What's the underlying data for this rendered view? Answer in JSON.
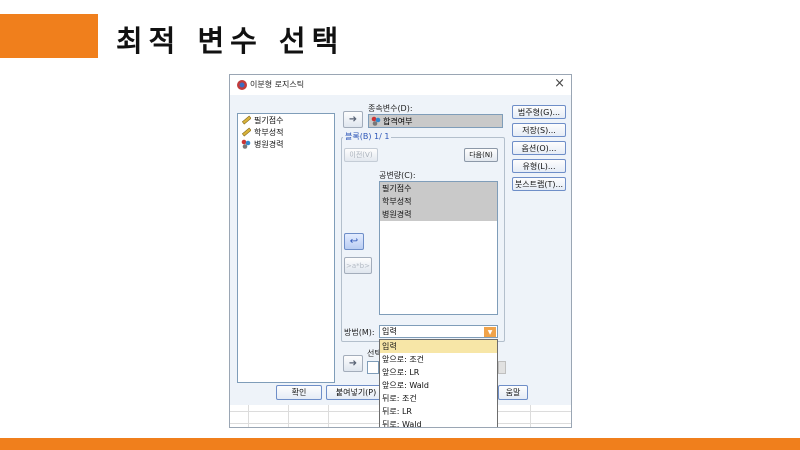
{
  "slide": {
    "title": "최적 변수 선택",
    "accent_color": "#f07f1c"
  },
  "dialog": {
    "title": "이분형 로지스틱",
    "close_icon": "close-icon",
    "variables": [
      {
        "label": "필기점수",
        "icon": "ruler-icon"
      },
      {
        "label": "학부성적",
        "icon": "ruler-icon"
      },
      {
        "label": "병원경력",
        "icon": "nominal-icon"
      }
    ],
    "dependent_label": "종속변수(D):",
    "dependent_value": "합격여부",
    "block_label": "블록(B) 1/ 1",
    "prev_button": "이전(V)",
    "next_button": "다음(N)",
    "covariates_label": "공변량(C):",
    "covariates": [
      "필기점수",
      "학부성적",
      "병원경력"
    ],
    "interaction_button": ">a*b>",
    "method_label": "방법(M):",
    "method_value": "입력",
    "method_options": [
      "입력",
      "앞으로: 조건",
      "앞으로: LR",
      "앞으로: Wald",
      "뒤로: 조건",
      "뒤로: LR",
      "뒤로: Wald"
    ],
    "selection_label": "선택",
    "side_buttons": [
      "범주형(G)...",
      "저장(S)...",
      "옵션(O)...",
      "유형(L)...",
      "붓스트랩(T)..."
    ],
    "bottom_buttons": {
      "ok": "확인",
      "paste": "붙여넣기(P)",
      "help": "움말"
    }
  }
}
